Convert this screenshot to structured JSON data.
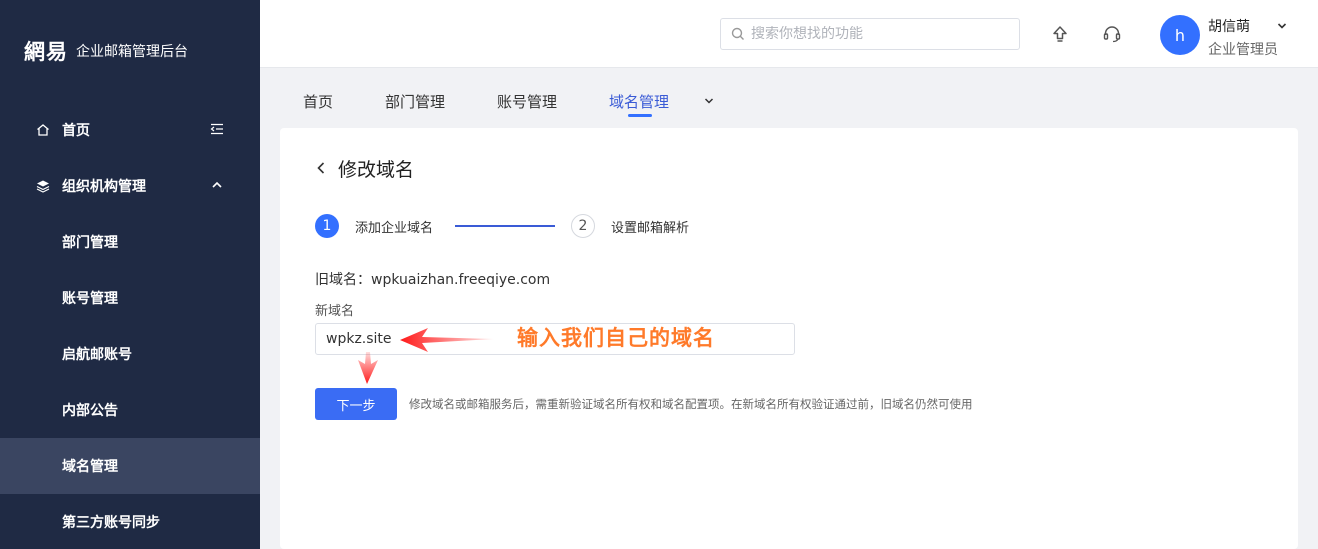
{
  "brand": {
    "logo": "網易",
    "title": "企业邮箱管理后台"
  },
  "sidebar": {
    "items": [
      {
        "label": "首页"
      },
      {
        "label": "组织机构管理"
      },
      {
        "label": "部门管理"
      },
      {
        "label": "账号管理"
      },
      {
        "label": "启航邮账号"
      },
      {
        "label": "内部公告"
      },
      {
        "label": "域名管理"
      },
      {
        "label": "第三方账号同步"
      }
    ]
  },
  "header": {
    "search_placeholder": "搜索你想找的功能",
    "user": {
      "initial": "h",
      "name": "胡信萌",
      "role": "企业管理员"
    }
  },
  "tabs": [
    {
      "label": "首页"
    },
    {
      "label": "部门管理"
    },
    {
      "label": "账号管理"
    },
    {
      "label": "域名管理"
    }
  ],
  "page": {
    "title": "修改域名",
    "steps": [
      {
        "num": "1",
        "label": "添加企业域名"
      },
      {
        "num": "2",
        "label": "设置邮箱解析"
      }
    ],
    "old_domain": "旧域名：wpkuaizhan.freeqiye.com",
    "new_domain_label": "新域名",
    "new_domain_value": "wpkz.site",
    "annotation": "输入我们自己的域名",
    "next_button": "下一步",
    "hint": "修改域名或邮箱服务后，需重新验证域名所有权和域名配置项。在新域名所有权验证通过前，旧域名仍然可使用"
  },
  "colors": {
    "sidebar_bg": "#1f2a44",
    "accent": "#3370ff",
    "annotation": "#ff7a2a",
    "arrow": "#ff2020"
  }
}
